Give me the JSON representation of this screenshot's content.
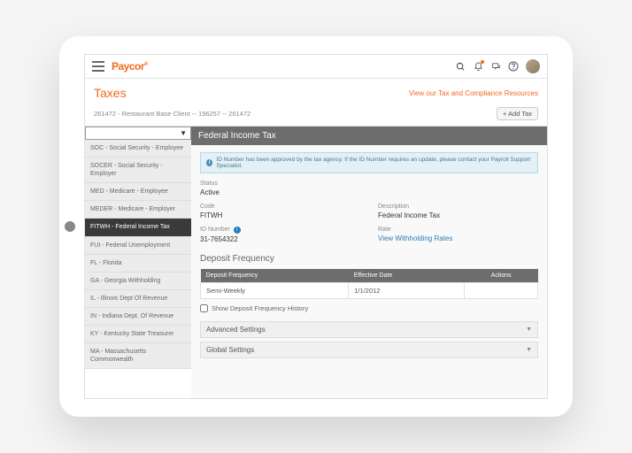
{
  "header": {
    "logo": "Paycor"
  },
  "page": {
    "title": "Taxes",
    "compliance_link": "View our Tax and Compliance Resources",
    "breadcrumb": "261472 - Restaurant Base Client -- 196257 -- 261472",
    "add_tax": "+ Add Tax"
  },
  "sidebar": {
    "search_placeholder": "",
    "items": [
      "SOC - Social Security - Employee",
      "SOCER - Social Security - Employer",
      "MED - Medicare - Employee",
      "MEDER - Medicare - Employer",
      "FITWH - Federal Income Tax",
      "FUI - Federal Unemployment",
      "FL - Florida",
      "GA - Georgia Withholding",
      "IL - Illinois Dept Of Revenue",
      "IN - Indiana Dept. Of Revenue",
      "KY - Kentucky State Treasurer",
      "MA - Massachusetts Commonwealth"
    ],
    "active_index": 4
  },
  "main": {
    "title": "Federal Income Tax",
    "banner": "ID Number has been approved by the tax agency. If the ID Number requires an update, please contact your Payroll Support Specialist.",
    "details": {
      "status_label": "Status",
      "status_value": "Active",
      "code_label": "Code",
      "code_value": "FITWH",
      "description_label": "Description",
      "description_value": "Federal Income Tax",
      "id_label": "ID Number",
      "id_value": "31-7654322",
      "rate_label": "Rate",
      "rate_link": "View Withholding Rates"
    },
    "deposit": {
      "section_title": "Deposit Frequency",
      "col_freq": "Deposit Frequency",
      "col_date": "Effective Date",
      "col_actions": "Actions",
      "row_freq": "Semi-Weekly",
      "row_date": "1/1/2012",
      "history_label": "Show Deposit Frequency History"
    },
    "accordion": {
      "advanced": "Advanced Settings",
      "global": "Global Settings"
    }
  }
}
